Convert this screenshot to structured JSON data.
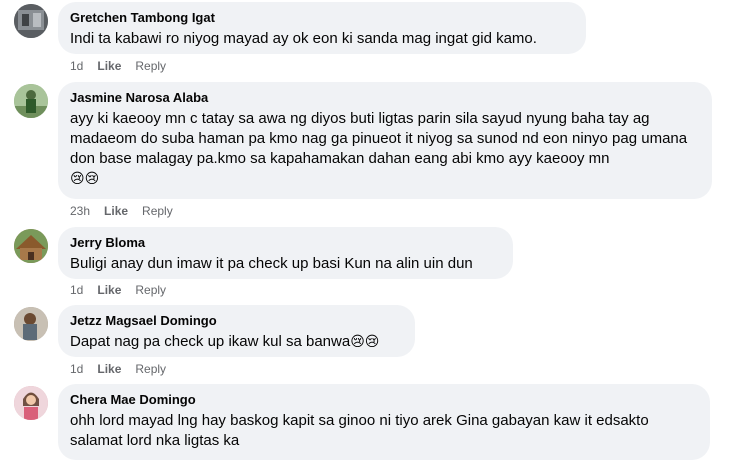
{
  "actions": {
    "like": "Like",
    "reply": "Reply"
  },
  "comments": [
    {
      "name": "Gretchen Tambong Igat",
      "text": "Indi ta kabawi ro niyog mayad ay ok eon ki sanda mag ingat gid kamo.",
      "emoji": "",
      "time": "1d",
      "avatar_color": "#6b6f73"
    },
    {
      "name": "Jasmine Narosa Alaba",
      "text": "ayy ki kaeooy mn c tatay sa awa ng diyos buti ligtas parin sila sayud nyung baha tay ag madaeom do suba haman pa kmo nag ga pinueot it niyog sa sunod nd eon ninyo pag umana don base malagay pa.kmo sa kapahamakan dahan eang abi kmo ayy kaeooy mn",
      "emoji": "😢😢",
      "time": "23h",
      "avatar_color": "#7fa46a"
    },
    {
      "name": "Jerry Bloma",
      "text": "Buligi anay dun imaw it pa check up basi Kun na alin uin dun",
      "emoji": "",
      "time": "1d",
      "avatar_color": "#8a6a3c"
    },
    {
      "name": "Jetzz Magsael Domingo",
      "text": "Dapat nag pa check up ikaw kul sa banwa",
      "emoji": "😢😢",
      "time": "1d",
      "avatar_color": "#9c8f80"
    },
    {
      "name": "Chera Mae Domingo",
      "text": "ohh lord mayad lng hay baskog kapit sa ginoo ni tiyo arek Gina gabayan kaw it edsakto salamat lord nka ligtas ka",
      "emoji": "",
      "time": "",
      "avatar_color": "#d79aa6"
    }
  ]
}
